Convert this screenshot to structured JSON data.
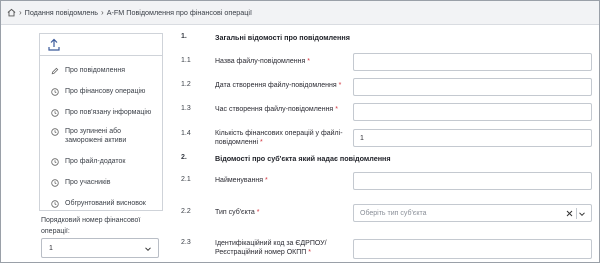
{
  "breadcrumb": {
    "home_icon": "home-icon",
    "link": "Подання повідомлень",
    "current": "A-FM Повідомлення про фінансові операції"
  },
  "sidebar": {
    "upload_icon": "upload-icon",
    "items": [
      {
        "icon": "pencil-icon",
        "label": "Про повідомлення"
      },
      {
        "icon": "clock-icon",
        "label": "Про фінансову операцію"
      },
      {
        "icon": "clock-icon",
        "label": "Про пов'язану інформацію"
      },
      {
        "icon": "clock-icon",
        "label": "Про зупинені або заморожені активи"
      },
      {
        "icon": "clock-icon",
        "label": "Про файл-додаток"
      },
      {
        "icon": "clock-icon",
        "label": "Про учасників"
      },
      {
        "icon": "clock-icon",
        "label": "Обгрунтований висновок"
      }
    ],
    "sequence_label": "Порядковий номер фінансової операції:",
    "sequence_value": "1"
  },
  "form": {
    "section1": {
      "number": "1.",
      "title": "Загальні відомості про повідомлення"
    },
    "rows1": [
      {
        "number": "1.1",
        "label": "Назва файлу-повідомлення",
        "required": "*",
        "value": ""
      },
      {
        "number": "1.2",
        "label": "Дата створення файлу-повідомлення",
        "required": "*",
        "value": ""
      },
      {
        "number": "1.3",
        "label": "Час створення файлу-повідомлення",
        "required": "*",
        "value": ""
      },
      {
        "number": "1.4",
        "label": "Кількість фінансових операцій у файлі-повідомленні",
        "required": "*",
        "value": "1"
      }
    ],
    "section2": {
      "number": "2.",
      "title": "Відомості про суб'єкта який надає повідомлення"
    },
    "rows2": [
      {
        "number": "2.1",
        "label": "Найменування",
        "required": "*",
        "value": ""
      },
      {
        "number": "2.2",
        "label": "Тип суб'єкта",
        "required": "*",
        "placeholder": "Оберіть тип суб'єкта"
      },
      {
        "number": "2.3",
        "label": "Ідентифікаційний код за ЄДРПОУ/ Реєстраційний номер ОКПП",
        "required": "*",
        "value": ""
      }
    ]
  },
  "colors": {
    "required": "#d2323c",
    "border": "#c4c9d0"
  }
}
